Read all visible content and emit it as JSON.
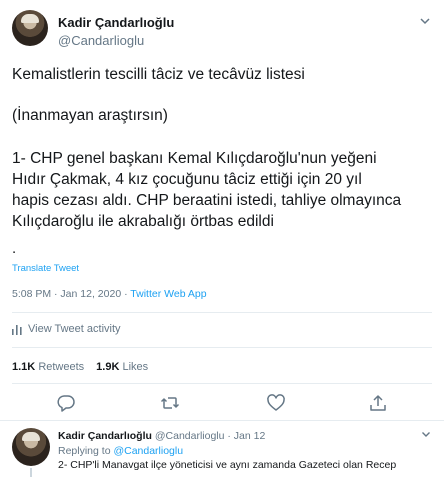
{
  "tweet": {
    "author": "Kadir Çandarlıoğlu",
    "handle": "@Candarlioglu",
    "lines": {
      "l1": "Kemalistlerin tescilli tâciz ve tecâvüz listesi",
      "l2": "(İnanmayan araştırsın)",
      "p3": [
        "1- CHP genel başkanı Kemal Kılıçdaroğlu'nun yeğeni",
        "Hıdır Çakmak, 4 kız çocuğunu tâciz ettiği için 20 yıl",
        "hapis cezası aldı. CHP beraatini istedi, tahliye olmayınca",
        "Kılıçdaroğlu ile akrabalığı örtbas edildi"
      ],
      "dot": "."
    },
    "translate": "Translate Tweet",
    "time": "5:08 PM · Jan 12, 2020 · ",
    "client": "Twitter Web App",
    "activity": "View Tweet activity",
    "stats": {
      "retweets_count": "1.1K",
      "retweets_label": "Retweets",
      "likes_count": "1.9K",
      "likes_label": "Likes"
    },
    "icons": {
      "reply": "reply-icon",
      "retweet": "retweet-icon",
      "like": "heart-icon",
      "share": "share-icon",
      "caret": "chevron-down-icon",
      "activity": "bar-chart-icon"
    },
    "colors": {
      "accent": "#1da1f2",
      "muted": "#657786",
      "text": "#14171a",
      "border": "#e6ecf0"
    }
  },
  "reply": {
    "author": "Kadir Çandarlıoğlu",
    "handle_date": "@Candarlioglu · Jan 12",
    "replying_prefix": "Replying to ",
    "replying_handle": "@Candarlioglu",
    "text": "2- CHP'li Manavgat ilçe yöneticisi ve aynı zamanda Gazeteci olan Recep"
  }
}
